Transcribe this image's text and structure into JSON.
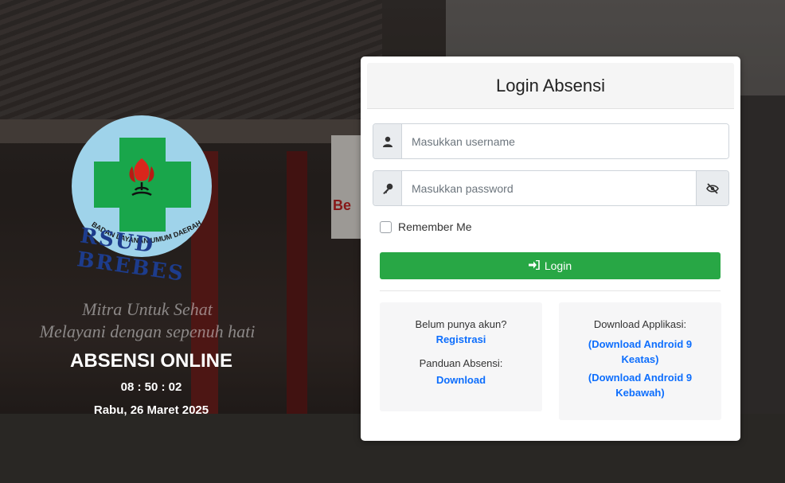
{
  "left": {
    "motto_line1": "Mitra Untuk Sehat",
    "motto_line2": "Melayani dengan sepenuh hati",
    "app_title": "ABSENSI ONLINE",
    "clock": "08 : 50 : 02",
    "date": "Rabu, 26 Maret 2025",
    "logo": {
      "arc_text": "BADAN LAYANAN UMUM DAERAH",
      "name_text": "RSUD BREBES",
      "colors": {
        "circle": "#9fd3ea",
        "cross": "#19a64b",
        "flower": "#d9261c",
        "name": "#1d3c8c"
      }
    }
  },
  "login": {
    "title": "Login Absensi",
    "username_placeholder": "Masukkan username",
    "password_placeholder": "Masukkan password",
    "remember_label": "Remember Me",
    "login_label": "Login",
    "icons": {
      "username": "user-icon",
      "password": "key-icon",
      "toggle": "eye-slash-icon",
      "login": "sign-in-icon"
    },
    "accent_color": "#28a745"
  },
  "info": {
    "no_account_text": "Belum punya akun?",
    "register_link": "Registrasi",
    "guide_text": "Panduan Absensi:",
    "guide_link": "Download",
    "download_text": "Download Applikasi:",
    "android_up_link": "(Download Android 9 Keatas)",
    "android_down_link": "(Download Android 9 Kebawah)",
    "link_color": "#0d6efd"
  }
}
